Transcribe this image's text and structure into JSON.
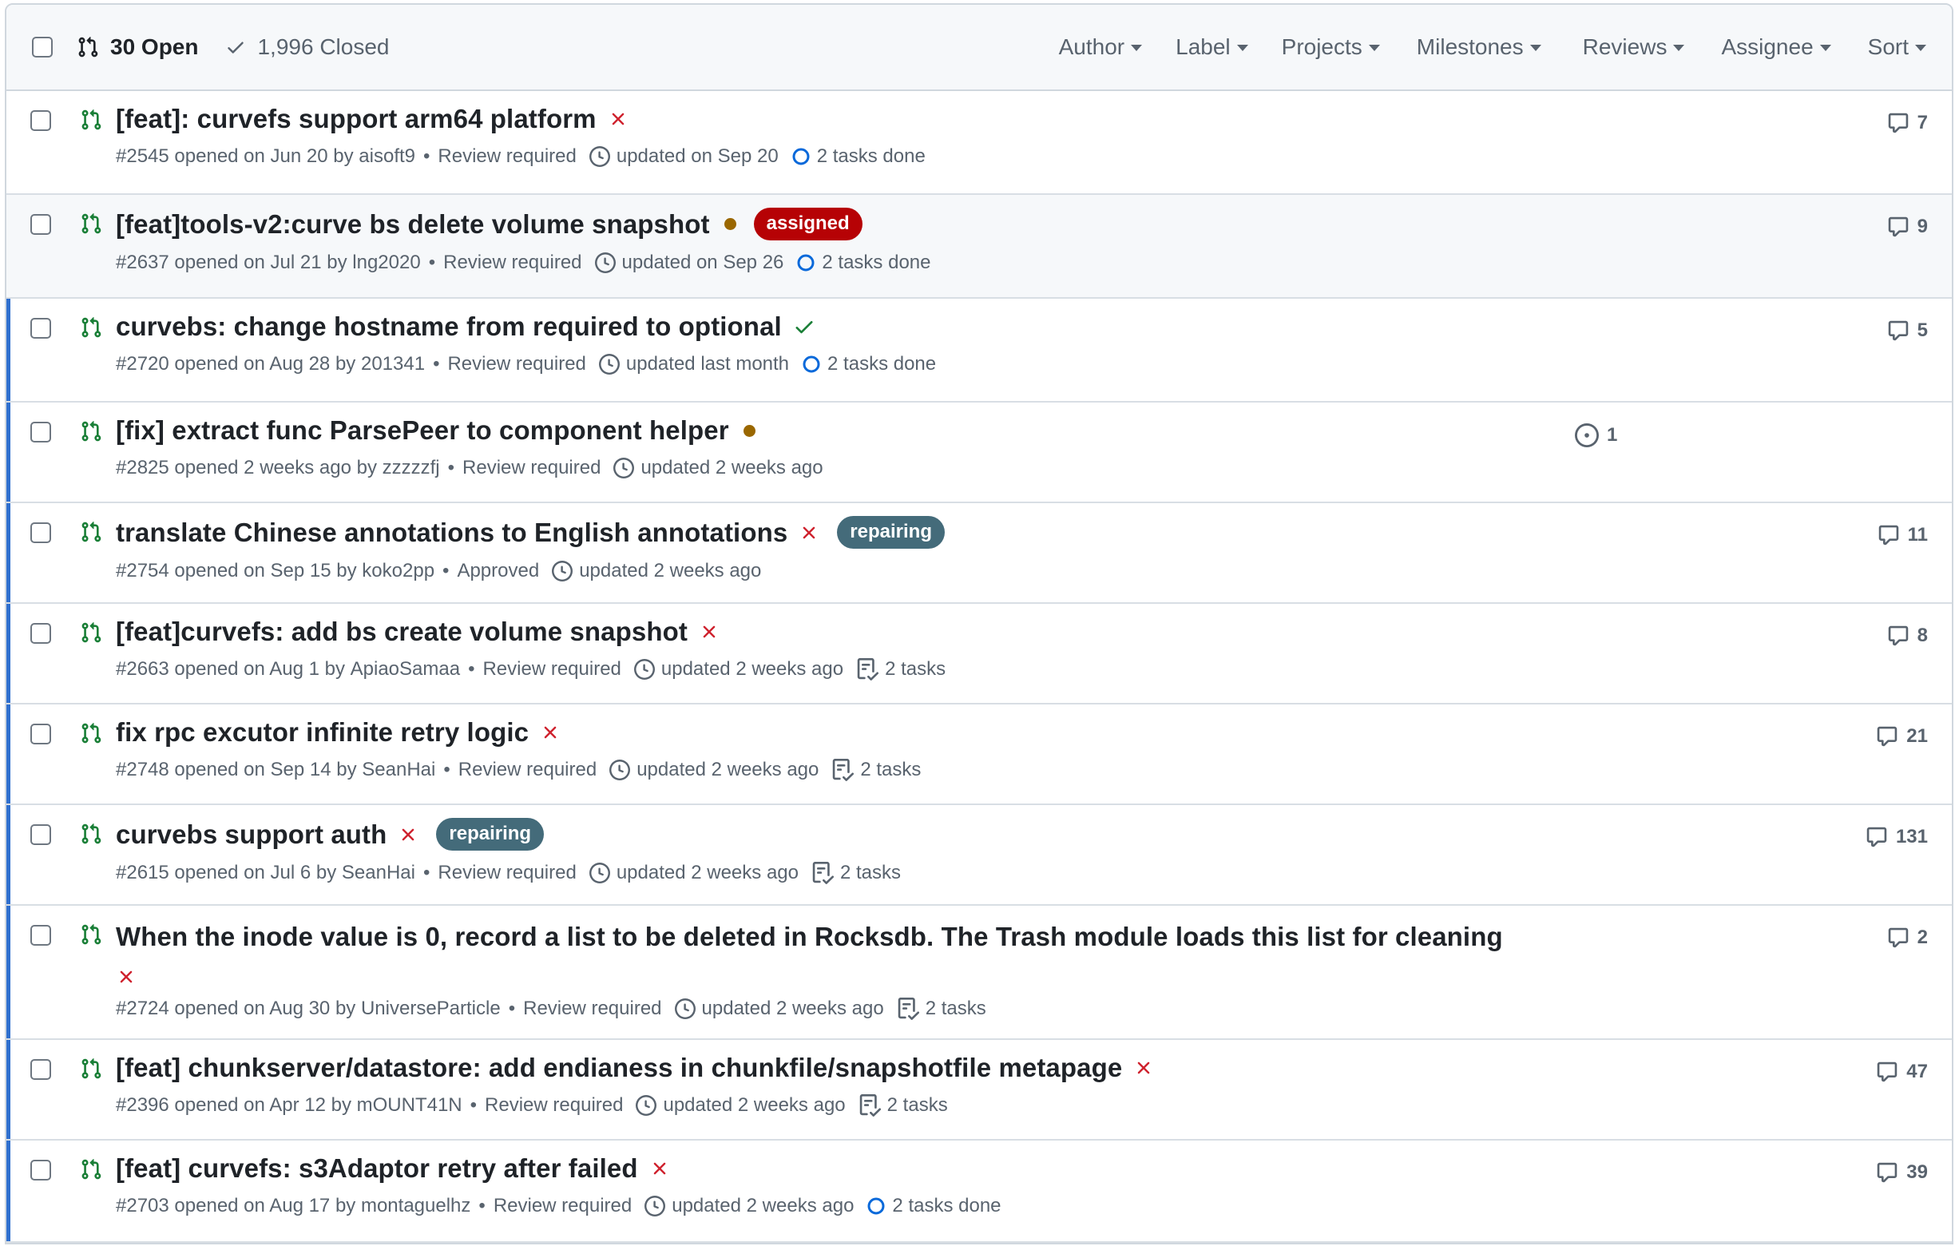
{
  "header": {
    "open_label": "30 Open",
    "closed_label": "1,996 Closed",
    "filters": [
      "Author",
      "Label",
      "Projects",
      "Milestones",
      "Reviews",
      "Assignee",
      "Sort"
    ]
  },
  "colors": {
    "open_green": "#1a7f37",
    "fail_red": "#cf222e",
    "pending_dot": "#9a6700",
    "accent_blue": "#2f6fce",
    "label_assigned": "#b60205",
    "label_repairing": "#446b7a"
  },
  "prs": [
    {
      "title": "[feat]: curvefs support arm64 platform",
      "status": "failure",
      "label": null,
      "number": "#2545",
      "opened": "opened on Jun 20 by",
      "author": "aisoft9",
      "review": "Review required",
      "updated": "updated on Sep 20",
      "tasks": "2 tasks done",
      "tasks_icon": "progress-ring-icon",
      "comments": "7"
    },
    {
      "title": "[feat]tools-v2:curve bs delete volume snapshot",
      "status": "pending",
      "label": "assigned",
      "label_color": "#b60205",
      "number": "#2637",
      "opened": "opened on Jul 21 by",
      "author": "lng2020",
      "review": "Review required",
      "updated": "updated on Sep 26",
      "tasks": "2 tasks done",
      "tasks_icon": "progress-ring-icon",
      "comments": "9"
    },
    {
      "title": "curvebs: change hostname from required to optional",
      "status": "success",
      "label": null,
      "number": "#2720",
      "opened": "opened on Aug 28 by",
      "author": "201341",
      "review": "Review required",
      "updated": "updated last month",
      "tasks": "2 tasks done",
      "tasks_icon": "progress-ring-icon",
      "comments": "5"
    },
    {
      "title": "[fix] extract func ParsePeer to component helper",
      "status": "pending",
      "label": null,
      "number": "#2825",
      "opened": "opened 2 weeks ago by",
      "author": "zzzzzfj",
      "review": "Review required",
      "updated": "updated 2 weeks ago",
      "tasks": null,
      "linked_issues": "1",
      "comments": null
    },
    {
      "title": "translate Chinese annotations to English annotations",
      "status": "failure",
      "label": "repairing",
      "label_color": "#446b7a",
      "number": "#2754",
      "opened": "opened on Sep 15 by",
      "author": "koko2pp",
      "review": "Approved",
      "updated": "updated 2 weeks ago",
      "tasks": null,
      "comments": "11"
    },
    {
      "title": "[feat]curvefs: add bs create volume snapshot",
      "status": "failure",
      "label": null,
      "number": "#2663",
      "opened": "opened on Aug 1 by",
      "author": "ApiaoSamaa",
      "review": "Review required",
      "updated": "updated 2 weeks ago",
      "tasks": "2 tasks",
      "tasks_icon": "checklist-icon",
      "comments": "8"
    },
    {
      "title": "fix rpc excutor infinite retry logic",
      "status": "failure",
      "label": null,
      "number": "#2748",
      "opened": "opened on Sep 14 by",
      "author": "SeanHai",
      "review": "Review required",
      "updated": "updated 2 weeks ago",
      "tasks": "2 tasks",
      "tasks_icon": "checklist-icon",
      "comments": "21"
    },
    {
      "title": "curvebs support auth",
      "status": "failure",
      "label": "repairing",
      "label_color": "#446b7a",
      "number": "#2615",
      "opened": "opened on Jul 6 by",
      "author": "SeanHai",
      "review": "Review required",
      "updated": "updated 2 weeks ago",
      "tasks": "2 tasks",
      "tasks_icon": "checklist-icon",
      "comments": "131"
    },
    {
      "title": "When the inode value is 0, record a list to be deleted in Rocksdb. The Trash module loads this list for cleaning",
      "status": "failure",
      "label": null,
      "number": "#2724",
      "opened": "opened on Aug 30 by",
      "author": "UniverseParticle",
      "review": "Review required",
      "updated": "updated 2 weeks ago",
      "tasks": "2 tasks",
      "tasks_icon": "checklist-icon",
      "comments": "2"
    },
    {
      "title": "[feat] chunkserver/datastore: add endianess in chunkfile/snapshotfile metapage",
      "status": "failure",
      "label": null,
      "number": "#2396",
      "opened": "opened on Apr 12 by",
      "author": "mOUNT41N",
      "review": "Review required",
      "updated": "updated 2 weeks ago",
      "tasks": "2 tasks",
      "tasks_icon": "checklist-icon",
      "comments": "47"
    },
    {
      "title": "[feat] curvefs: s3Adaptor retry after failed",
      "status": "failure",
      "label": null,
      "number": "#2703",
      "opened": "opened on Aug 17 by",
      "author": "montaguelhz",
      "review": "Review required",
      "updated": "updated 2 weeks ago",
      "tasks": "2 tasks done",
      "tasks_icon": "progress-ring-icon",
      "comments": "39"
    }
  ]
}
